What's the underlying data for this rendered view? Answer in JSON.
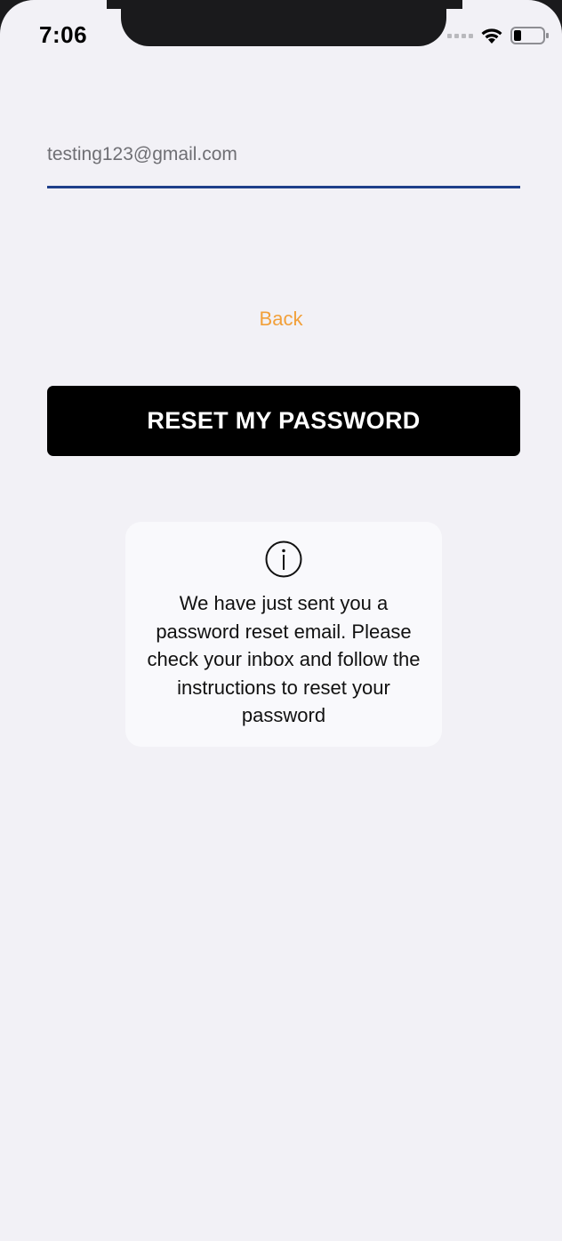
{
  "status_bar": {
    "time": "7:06"
  },
  "form": {
    "email_value": "testing123@gmail.com",
    "back_label": "Back",
    "reset_button_label": "RESET MY PASSWORD"
  },
  "info_card": {
    "icon": "info-icon",
    "message": "We have just sent you a password reset email. Please check your inbox and follow the instructions to reset your password"
  },
  "colors": {
    "background": "#f2f1f6",
    "accent_link": "#f2a03a",
    "field_underline": "#1e3f8a",
    "button_bg": "#000000"
  }
}
